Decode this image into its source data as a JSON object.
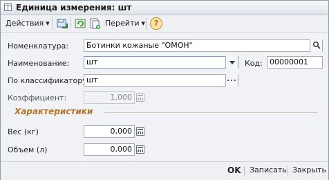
{
  "window": {
    "title": "Единица измерения: шт"
  },
  "toolbar": {
    "actions_label": "Действия",
    "goto_label": "Перейти",
    "help_label": "?"
  },
  "form": {
    "nomenclature": {
      "label": "Номенклатура:",
      "value": "Ботинки кожаные \"ОМОН\""
    },
    "name": {
      "label": "Наименование:",
      "value": "шт"
    },
    "code": {
      "label": "Код:",
      "value": "00000001"
    },
    "classifier": {
      "label": "По классификатору:",
      "value": "шт"
    },
    "coefficient": {
      "label": "Коэффициент:",
      "value": "1,000"
    },
    "section_title": "Характеристики",
    "weight": {
      "label": "Вес (кг)",
      "value": "0,000"
    },
    "volume": {
      "label": "Объем (л)",
      "value": "0,000"
    }
  },
  "footer": {
    "ok_label": "OK",
    "save_label": "Записать",
    "close_label": "Закрыть"
  }
}
